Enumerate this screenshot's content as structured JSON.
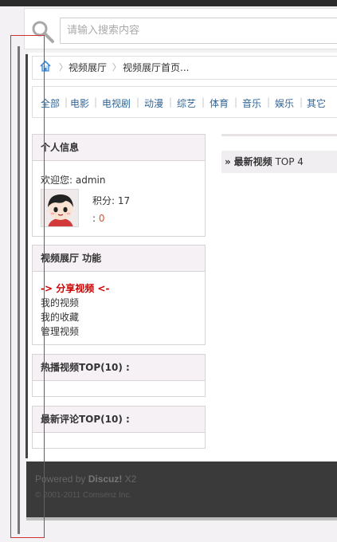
{
  "search": {
    "placeholder": "请输入搜索内容"
  },
  "breadcrumb": {
    "items": [
      "视频展厅",
      "视频展厅首页..."
    ],
    "separator": "〉"
  },
  "categories": [
    "全部",
    "电影",
    "电视剧",
    "动漫",
    "综艺",
    "体育",
    "音乐",
    "娱乐",
    "其它"
  ],
  "profile": {
    "title": "个人信息",
    "welcome": "欢迎您: admin",
    "points": "积分: 17",
    "extra_prefix": ": ",
    "extra_value": "0"
  },
  "functions": {
    "title": "视频展厅 功能",
    "share": "-> 分享视频 <-",
    "links": [
      "我的视频",
      "我的收藏",
      "管理视频"
    ]
  },
  "hot": {
    "title": "热播视频TOP(10) :"
  },
  "comments": {
    "title": "最新评论TOP(10) :"
  },
  "latest": {
    "arrow": "»",
    "title": "最新视频",
    "suffix": "TOP 4"
  },
  "footer": {
    "powered_prefix": "Powered by ",
    "powered_brand": "Discuz!",
    "powered_version": " X2",
    "copyright": "© 2001-2011 Comsenz Inc."
  },
  "colors": {
    "link_blue": "#336699",
    "share_red": "#cc0000",
    "value_orange": "#e05020",
    "footer_bg": "#3a3a3a"
  }
}
